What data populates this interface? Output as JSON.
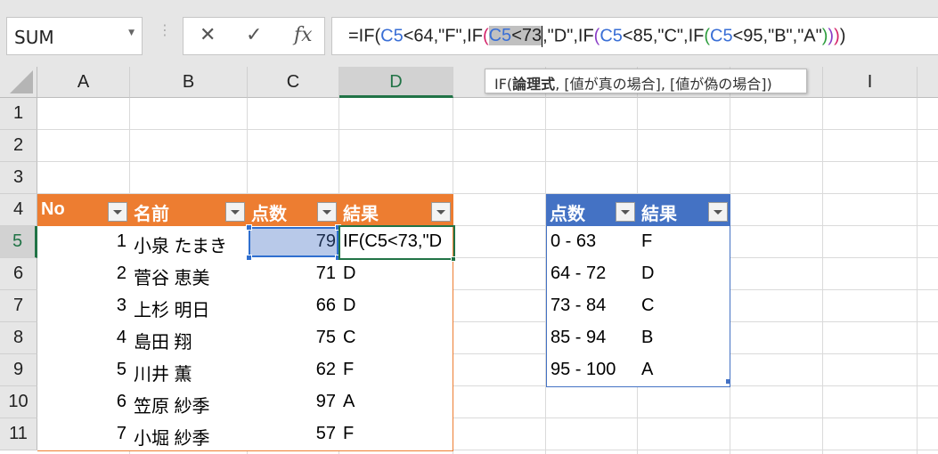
{
  "name_box": {
    "value": "SUM"
  },
  "formula_bar": {
    "cancel_icon": "✕",
    "enter_icon": "✓",
    "fx_label": "fx",
    "segments": [
      {
        "t": "=IF(",
        "c": "#222222"
      },
      {
        "t": "C5",
        "c": "#3a6fd6"
      },
      {
        "t": "<64,\"F\",IF",
        "c": "#222222"
      },
      {
        "t": "(",
        "c": "#d4246a"
      },
      {
        "t": "C5",
        "c": "#3a6fd6",
        "sel": true
      },
      {
        "t": "<73",
        "c": "#222222",
        "sel": true
      },
      {
        "t": "|caret",
        "c": ""
      },
      {
        "t": ",\"D\",IF",
        "c": "#222222"
      },
      {
        "t": "(",
        "c": "#8a3fc7"
      },
      {
        "t": "C5",
        "c": "#3a6fd6"
      },
      {
        "t": "<85,\"C\",IF",
        "c": "#222222"
      },
      {
        "t": "(",
        "c": "#2e9e3e"
      },
      {
        "t": "C5",
        "c": "#3a6fd6"
      },
      {
        "t": "<95,\"B\",\"A\"",
        "c": "#222222"
      },
      {
        "t": ")",
        "c": "#2e9e3e"
      },
      {
        "t": ")",
        "c": "#8a3fc7"
      },
      {
        "t": ")",
        "c": "#d4246a"
      },
      {
        "t": ")",
        "c": "#222222"
      }
    ]
  },
  "tooltip": {
    "prefix": "IF(",
    "bold": "論理式",
    "rest": ", [値が真の場合], [値が偽の場合])"
  },
  "columns": [
    "A",
    "B",
    "C",
    "D",
    "E",
    "F",
    "G",
    "H",
    "I",
    ""
  ],
  "rows": [
    "1",
    "2",
    "3",
    "4",
    "5",
    "6",
    "7",
    "8",
    "9",
    "10",
    "11"
  ],
  "selected": {
    "column": "D",
    "row": "5"
  },
  "table1": {
    "header_color": "#ed7d31",
    "headers": [
      "No",
      "名前",
      "点数",
      "結果"
    ],
    "rows": [
      [
        "1",
        "小泉 たまき",
        "79",
        "IF(C5<73,\"D"
      ],
      [
        "2",
        "菅谷 恵美",
        "71",
        "D"
      ],
      [
        "3",
        "上杉 明日",
        "66",
        "D"
      ],
      [
        "4",
        "島田 翔",
        "75",
        "C"
      ],
      [
        "5",
        "川井 薫",
        "62",
        "F"
      ],
      [
        "6",
        "笠原 紗季",
        "97",
        "A"
      ],
      [
        "7",
        "小堀 紗季",
        "57",
        "F"
      ]
    ]
  },
  "table2": {
    "header_color": "#4472c4",
    "headers": [
      "点数",
      "結果"
    ],
    "rows": [
      [
        "0 - 63",
        "F"
      ],
      [
        "64 - 72",
        "D"
      ],
      [
        "73 - 84",
        "C"
      ],
      [
        "85 - 94",
        "B"
      ],
      [
        "95 - 100",
        "A"
      ]
    ]
  }
}
